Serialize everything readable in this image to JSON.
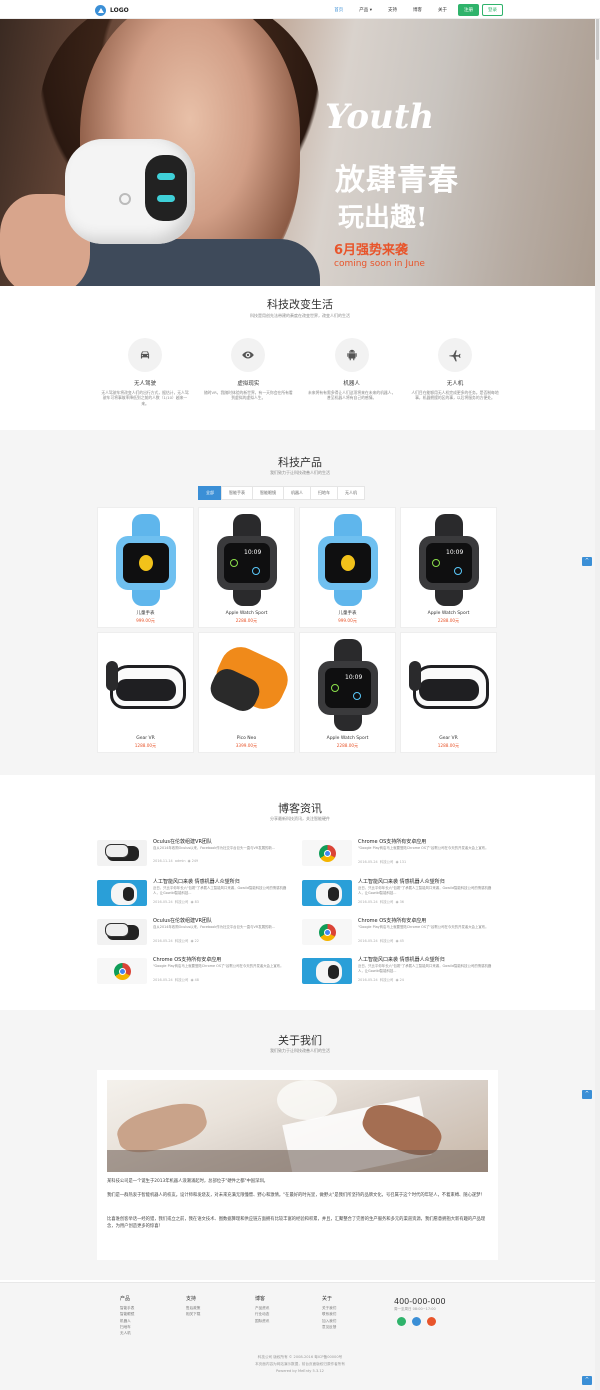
{
  "nav": {
    "logo_text": "LOGO",
    "items": [
      "首页",
      "产品 ▾",
      "支持",
      "博客",
      "关于"
    ],
    "login": "注册",
    "register": "登录"
  },
  "hero": {
    "slogan_en": "Youth",
    "slogan_line1": "放肆青春",
    "slogan_line2": "玩出趣!",
    "date_cn": "6月强势来袭",
    "date_en": "coming soon in June"
  },
  "features": {
    "title": "科技改变生活",
    "subtitle": "科技是用创先法带建的奏度在改变世界，改变人们的生活",
    "items": [
      {
        "icon": "car-icon",
        "name": "无人驾驶",
        "desc": "无人驾驶车将改变人们的出行方式，据估计，无人驾驶车可将事故率降低到之前的人数（1/10）越来一来。"
      },
      {
        "icon": "eye-icon",
        "name": "虚拟现实",
        "desc": "随时VR，我随时体验的新世界，有一天你会在所有看到虚拟的虚拟人生。"
      },
      {
        "icon": "android-icon",
        "name": "机器人",
        "desc": "未来将有有需多得让人们这项将来在未来的机器人，甚至机器人将有自己的感情。"
      },
      {
        "icon": "plane-icon",
        "name": "无人机",
        "desc": "人们目在能够用无人机完成更多的任务。是否制每地事，机器拥援的区的事，以后将服务的方便处。"
      }
    ]
  },
  "products": {
    "title": "科技产品",
    "subtitle": "我们致力于让科技改善人们的生活",
    "tabs": [
      "全部",
      "智能手表",
      "智能眼镜",
      "机器人",
      "扫地车",
      "无人机"
    ],
    "items": [
      {
        "type": "kidwatch",
        "name": "儿童手表",
        "price": "999.00元"
      },
      {
        "type": "applewatch",
        "name": "Apple Watch Sport",
        "price": "2288.00元"
      },
      {
        "type": "kidwatch",
        "name": "儿童手表",
        "price": "999.00元"
      },
      {
        "type": "applewatch",
        "name": "Apple Watch Sport",
        "price": "2288.00元"
      },
      {
        "type": "gearvr",
        "name": "Gear VR",
        "price": "1288.00元"
      },
      {
        "type": "piconeo",
        "name": "Pico Neo",
        "price": "3399.00元"
      },
      {
        "type": "applewatch",
        "name": "Apple Watch Sport",
        "price": "2288.00元"
      },
      {
        "type": "gearvr",
        "name": "Gear VR",
        "price": "1288.00元"
      }
    ]
  },
  "blog": {
    "title": "博客资讯",
    "subtitle": "分享最新科技资讯，关注智能硬件",
    "posts": [
      {
        "thumb": "vr",
        "title": "Oculus在伦敦组建VR团队",
        "desc": "自从2014年收购Oculus以来，Facebook作为社交平台巨头一直与VR发展的新...",
        "date": "2016-11-14",
        "author": "admin",
        "views": "249"
      },
      {
        "thumb": "chrome",
        "title": "Chrome OS支持所有安卓应用",
        "desc": "\"Google Play商店马上就要登陆Chrome OS了\"谷歌公司在今天的开发者大会上宣布。",
        "date": "2016-05-24",
        "author": "科技公司",
        "views": "131"
      },
      {
        "thumb": "robot",
        "title": "人工智能风口来袭 情感机器人众望所归",
        "desc": "近日，只比平你年长六\"包裹\"了承载人工智能风口来袭，Gowild智能科技公司的情感机器人，让Gowild智能科技...",
        "date": "2016-05-24",
        "author": "科技公司",
        "views": "83"
      },
      {
        "thumb": "robot",
        "title": "人工智能风口来袭 情感机器人众望所归",
        "desc": "近日，只比平你年长六\"包裹\"了承载人工智能风口来袭，Gowild智能科技公司的情感机器人，让Gowild智能科技...",
        "date": "2016-05-24",
        "author": "科技公司",
        "views": "36"
      },
      {
        "thumb": "vr",
        "title": "Oculus在伦敦组建VR团队",
        "desc": "自从2014年收购Oculus以来，Facebook作为社交平台巨头一直与VR发展的新...",
        "date": "2016-05-24",
        "author": "科技公司",
        "views": "22"
      },
      {
        "thumb": "chrome",
        "title": "Chrome OS支持所有安卓应用",
        "desc": "\"Google Play商店马上就要登陆Chrome OS了\"谷歌公司在今天的开发者大会上宣布。",
        "date": "2016-05-24",
        "author": "科技公司",
        "views": "45"
      },
      {
        "thumb": "chrome",
        "title": "Chrome OS支持所有安卓应用",
        "desc": "\"Google Play商店马上就要登陆Chrome OS了\"谷歌公司在今天的开发者大会上宣布。",
        "date": "2016-05-24",
        "author": "科技公司",
        "views": "48"
      },
      {
        "thumb": "robot",
        "title": "人工智能风口来袭 情感机器人众望所归",
        "desc": "近日，只比平你年长六\"包裹\"了承载人工智能风口来袭，Gowild智能科技公司的情感机器人，让Gowild智能科技...",
        "date": "2016-05-24",
        "author": "科技公司",
        "views": "24"
      }
    ]
  },
  "about": {
    "title": "关于我们",
    "subtitle": "我们致力于让科技改善人们的生活",
    "p1": "某科技公司是一个诞生于2013年机器人浪潮涌起时，总部位于\"硬件之都\"中国深圳。",
    "p2": "我们是一群热衷于智能机器人的校友。设计师和发烧友，对未来充满无限憧憬、野心和激情。\"在最好的时光里，做野火\"是我们所坚持的品牌文化，号召属于这个时代的年轻人，不着束缚、随心遂梦！",
    "p3": "比喜谁创客举话一经的猎，我们或立之前，我在语文技术、图数据算理和供应链方面拥有比较丰富的经验和积累，并且，汇聚整合了完善的生产服务和多元的渠道资源，我们愿意拥抱大新有趣的产品理念，为用户创造更多的惊喜！"
  },
  "footer": {
    "cols": [
      {
        "h": "产品",
        "links": [
          "智能手表",
          "智能眼镜",
          "机器人",
          "扫地车",
          "无人机"
        ]
      },
      {
        "h": "支持",
        "links": [
          "售后政策",
          "相关下载"
        ]
      },
      {
        "h": "博客",
        "links": [
          "产品资讯",
          "行业动态",
          "国际资讯"
        ]
      },
      {
        "h": "关于",
        "links": [
          "关于我们",
          "联系我们",
          "加入我们",
          "意见反馈"
        ]
      }
    ],
    "phone": "400-000-000",
    "phone_sub": "周一至周日 08:00~17:00",
    "copyright": "科技公司 版权所有 © 2008-2016 粤ICP备00000号",
    "disclaimer": "本页面内容为网站演示数据，前台页面版权归原作者所有",
    "powered": "Powered by MeEnty 5.3.12"
  },
  "colors": {
    "accent": "#3b8fd6",
    "green": "#2fb36b",
    "price": "#e8552b"
  }
}
